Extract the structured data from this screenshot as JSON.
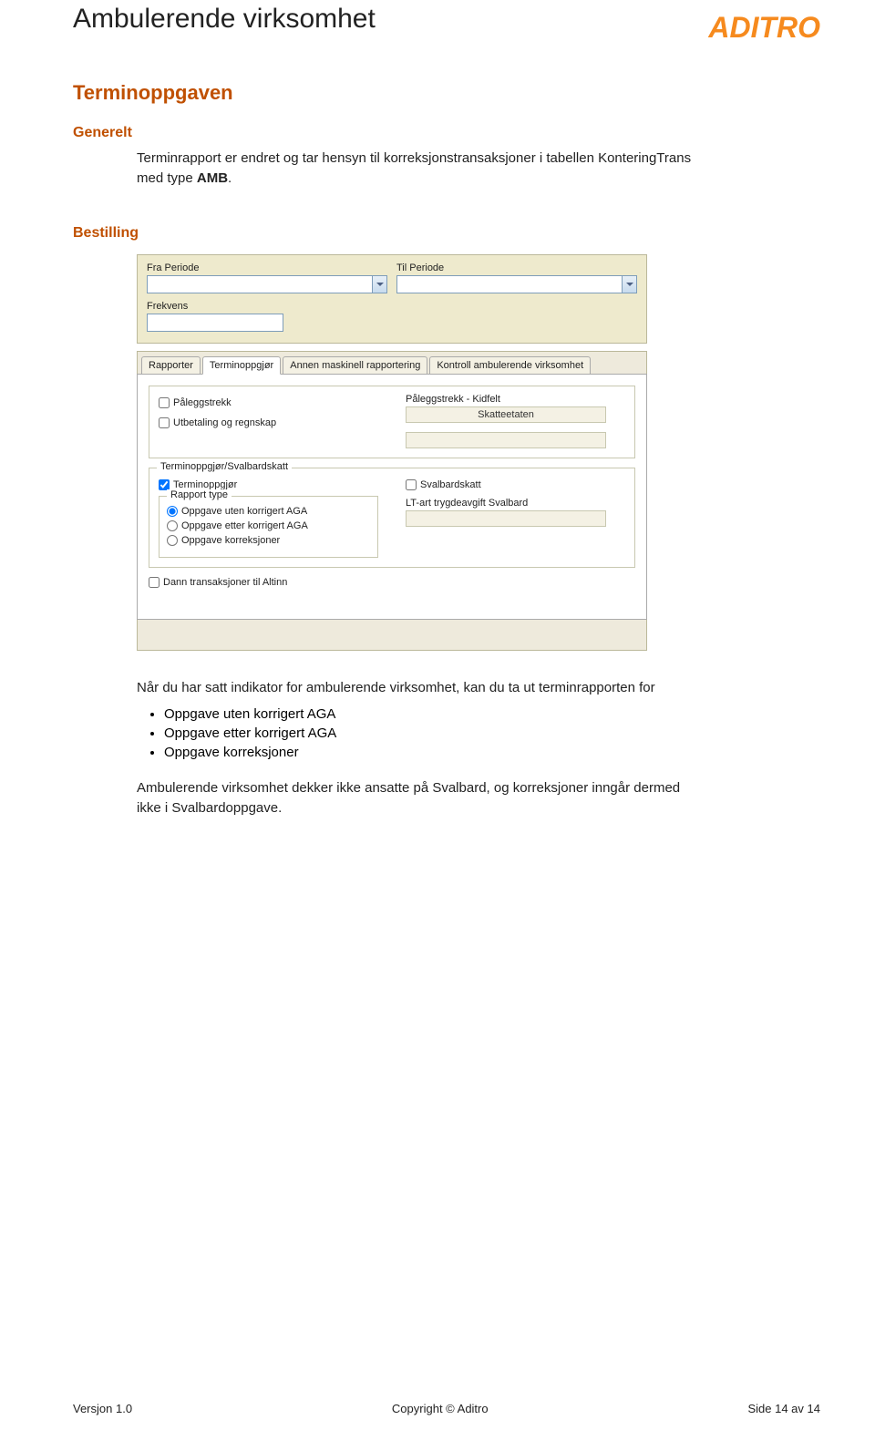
{
  "header": {
    "title": "Ambulerende virksomhet",
    "logo_text": "ADITRO"
  },
  "sections": {
    "terminoppgaven": "Terminoppgaven",
    "generelt": "Generelt",
    "bestilling": "Bestilling"
  },
  "intro_para_parts": {
    "a": "Terminrapport er endret og tar hensyn til korreksjonstransaksjoner i tabellen KonteringTrans med type ",
    "b": "AMB",
    "c": "."
  },
  "ss": {
    "fra_periode": "Fra Periode",
    "til_periode": "Til Periode",
    "frekvens": "Frekvens",
    "tabs": {
      "rapporter": "Rapporter",
      "terminoppgjor": "Terminoppgjør",
      "annen": "Annen maskinell rapportering",
      "kontroll": "Kontroll ambulerende virksomhet"
    },
    "box1": {
      "paleggstrekk": "Påleggstrekk",
      "utbetaling": "Utbetaling og regnskap",
      "kidlbl": "Påleggstrekk - Kidfelt",
      "skatteetaten": "Skatteetaten"
    },
    "box2": {
      "legend": "Terminoppgjør/Svalbardskatt",
      "terminoppgjor_cb": "Terminoppgjør",
      "svalbardskatt_cb": "Svalbardskatt",
      "rapporttype_legend": "Rapport type",
      "r1": "Oppgave uten korrigert AGA",
      "r2": "Oppgave etter korrigert AGA",
      "r3": "Oppgave korreksjoner",
      "ltart": "LT-art trygdeavgift Svalbard"
    },
    "dann_altinn": "Dann transaksjoner til Altinn"
  },
  "after_ss_para": "Når du har satt indikator for ambulerende virksomhet, kan du ta ut terminrapporten for",
  "bullets": [
    "Oppgave uten korrigert AGA",
    "Oppgave etter korrigert AGA",
    "Oppgave korreksjoner"
  ],
  "closing_para": "Ambulerende virksomhet dekker ikke ansatte på Svalbard, og korreksjoner inngår dermed ikke i Svalbardoppgave.",
  "footer": {
    "left": "Versjon 1.0",
    "center": "Copyright © Aditro",
    "right": "Side 14 av 14"
  }
}
